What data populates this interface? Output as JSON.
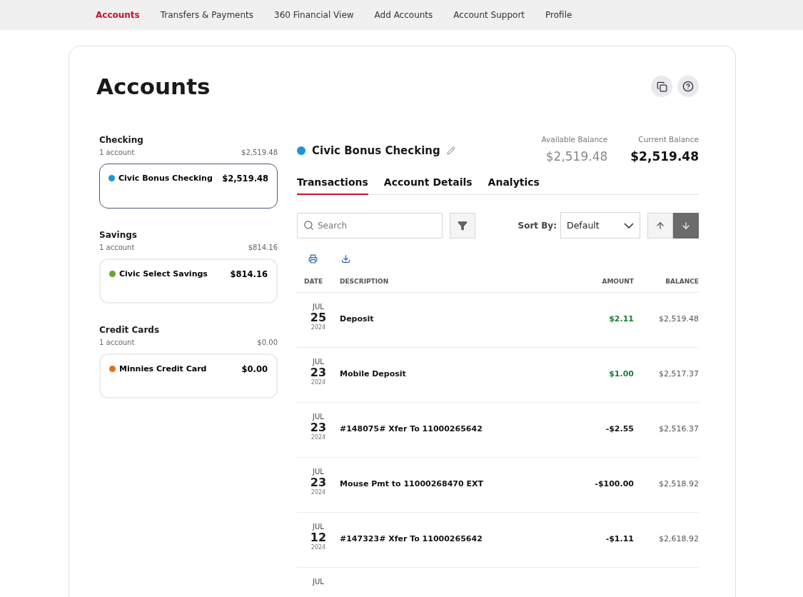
{
  "nav": [
    {
      "label": "Accounts",
      "selected": true
    },
    {
      "label": "Transfers & Payments",
      "selected": false
    },
    {
      "label": "360 Financial View",
      "selected": false
    },
    {
      "label": "Add Accounts",
      "selected": false
    },
    {
      "label": "Account Support",
      "selected": false
    },
    {
      "label": "Profile",
      "selected": false
    }
  ],
  "page_title": "Accounts",
  "groups": [
    {
      "name": "Checking",
      "count": "1 account",
      "total": "$2,519.48",
      "accounts": [
        {
          "name": "Civic Bonus Checking",
          "balance": "$2,519.48",
          "color": "#1a96d4",
          "selected": true
        }
      ]
    },
    {
      "name": "Savings",
      "count": "1 account",
      "total": "$814.16",
      "accounts": [
        {
          "name": "Civic Select Savings",
          "balance": "$814.16",
          "color": "#6aa52a",
          "selected": false
        }
      ]
    },
    {
      "name": "Credit Cards",
      "count": "1 account",
      "total": "$0.00",
      "accounts": [
        {
          "name": "Minnies Credit Card",
          "balance": "$0.00",
          "color": "#e0711c",
          "selected": false
        }
      ]
    }
  ],
  "account": {
    "name": "Civic Bonus Checking",
    "color": "#1a96d4",
    "available_label": "Available Balance",
    "available": "$2,519.48",
    "current_label": "Current Balance",
    "current": "$2,519.48"
  },
  "tabs": [
    {
      "label": "Transactions",
      "selected": true
    },
    {
      "label": "Account Details",
      "selected": false
    },
    {
      "label": "Analytics",
      "selected": false
    }
  ],
  "search": {
    "placeholder": "Search"
  },
  "sort": {
    "label": "Sort By:",
    "value": "Default",
    "directions": [
      {
        "kind": "up",
        "selected": false
      },
      {
        "kind": "down",
        "selected": true
      }
    ]
  },
  "table": {
    "columns": [
      "DATE",
      "DESCRIPTION",
      "AMOUNT",
      "BALANCE"
    ],
    "rows": [
      {
        "month": "JUL",
        "day": "25",
        "year": "2024",
        "description": "Deposit",
        "amount": "$2.11",
        "credit": true,
        "balance": "$2,519.48"
      },
      {
        "month": "JUL",
        "day": "23",
        "year": "2024",
        "description": "Mobile Deposit",
        "amount": "$1.00",
        "credit": true,
        "balance": "$2,517.37"
      },
      {
        "month": "JUL",
        "day": "23",
        "year": "2024",
        "description": "#148075# Xfer To 11000265642",
        "amount": "-$2.55",
        "credit": false,
        "balance": "$2,516.37"
      },
      {
        "month": "JUL",
        "day": "23",
        "year": "2024",
        "description": "Mouse Pmt to 11000268470 EXT",
        "amount": "-$100.00",
        "credit": false,
        "balance": "$2,518.92"
      },
      {
        "month": "JUL",
        "day": "12",
        "year": "2024",
        "description": "#147323# Xfer To 11000265642",
        "amount": "-$1.11",
        "credit": false,
        "balance": "$2,618.92"
      },
      {
        "month": "JUL"
      }
    ]
  }
}
